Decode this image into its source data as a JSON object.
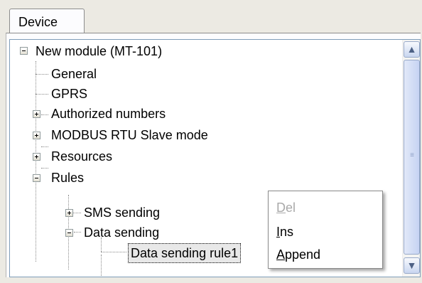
{
  "tab": {
    "label": "Device"
  },
  "tree": {
    "root": {
      "label": "New module  (MT-101)"
    },
    "general": {
      "label": "General"
    },
    "gprs": {
      "label": "GPRS"
    },
    "authorized": {
      "label": "Authorized numbers"
    },
    "modbus": {
      "label": "MODBUS RTU Slave mode"
    },
    "resources": {
      "label": "Resources"
    },
    "rules": {
      "label": "Rules"
    },
    "sms_sending": {
      "label": "SMS sending"
    },
    "data_sending": {
      "label": "Data sending"
    },
    "data_sending_rule1": {
      "label": "Data sending rule1"
    }
  },
  "context_menu": {
    "del": {
      "mnemonic": "D",
      "rest": "el",
      "enabled": false
    },
    "ins": {
      "mnemonic": "I",
      "rest": "ns",
      "enabled": true
    },
    "append": {
      "mnemonic": "A",
      "rest": "ppend",
      "enabled": true
    }
  },
  "scrollbar": {
    "up_icon": "▲",
    "down_icon": "▼",
    "grip": "≡"
  }
}
